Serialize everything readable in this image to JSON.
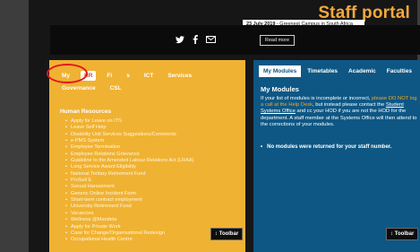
{
  "header": {
    "title": "Staff portal",
    "news": {
      "date": "23 July 2019",
      "text": " - Greenest Campus in South Africa #RZNP"
    },
    "read_more": "Read more",
    "social_icons": [
      "twitter-icon",
      "facebook-icon",
      "email-icon"
    ]
  },
  "left_panel": {
    "tabs_row1": [
      "My",
      "HR",
      "Fi",
      "s",
      "ICT",
      "Services"
    ],
    "tabs_row2": [
      "Governance",
      "CSL"
    ],
    "active_tab": "HR",
    "section_title": "Human Resources",
    "items": [
      "Apply for Leave on ITS",
      "Leave Self Help",
      "Disability Unit Services Suggestions/Comments",
      "e-PMS System",
      "Employee Termination",
      "Employee Relations Grievance",
      "Guideline to the Amended Labour Relations Act (LRAA)",
      "Long Service Award Eligibility",
      "National Tertiary Retirement Fund",
      "ProSell E",
      "Sexual Harassment",
      "Generic Online Incident Form",
      "Short-term contract employment",
      "University Retirement Fund",
      "Vacancies",
      "Wellness @Mandela",
      "Apply for Private Work",
      "Case for Change/Organisational Redesign",
      "Occupational Health Centre"
    ],
    "toolbar_label": "Toolbar"
  },
  "right_panel": {
    "tabs": [
      "My Modules",
      "Timetables",
      "Academic",
      "Faculties"
    ],
    "active_tab": "My Modules",
    "title": "My Modules",
    "text_1": "If your list of modules is incomplete or incorrect, ",
    "text_warn": "please DO NOT log a call at the Help Desk",
    "text_2": ", but instead please contact the ",
    "text_link": "Student Systems Office",
    "text_3": " and cc your HOD if you are not the HOD for the department. A staff member at the Systems Office will then attend to the corrections of your modules.",
    "note": "No modules were returned for your staff number.",
    "toolbar_label": "Toolbar"
  },
  "colors": {
    "portal_bg": "#161616",
    "left_panel": "#f0b232",
    "right_panel": "#0e5784",
    "title_accent": "#f2a93b",
    "highlight_ring": "#e2171c"
  }
}
